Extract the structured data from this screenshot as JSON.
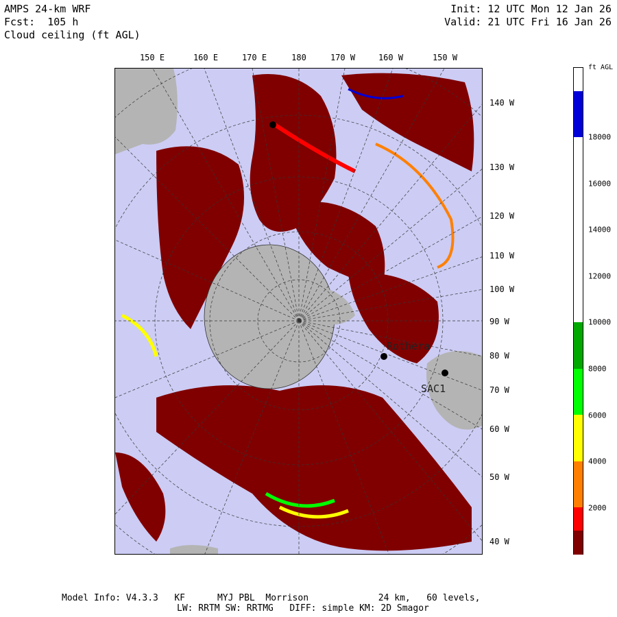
{
  "header": {
    "model": "AMPS 24-km WRF",
    "forecast": "Fcst:  105 h",
    "field": "Cloud ceiling (ft AGL)",
    "init": "Init: 12 UTC Mon 12 Jan 26",
    "valid": "Valid: 21 UTC Fri 16 Jan 26"
  },
  "longitude_labels_top": [
    "150 E",
    "160 E",
    "170 E",
    "180",
    "170 W",
    "160 W",
    "150 W"
  ],
  "longitude_labels_right": [
    "140 W",
    "130 W",
    "120 W",
    "110 W",
    "100 W",
    "90 W",
    "80 W",
    "70 W",
    "60 W",
    "50 W",
    "40 W"
  ],
  "colorbar": {
    "unit": "ft AGL",
    "ticks": [
      "18000",
      "16000",
      "14000",
      "12000",
      "10000",
      "8000",
      "6000",
      "4000",
      "2000"
    ],
    "colors": [
      "#ffffff",
      "#0000d8",
      "#0000d8",
      "#ffffff",
      "#ffffff",
      "#ffffff",
      "#ffffff",
      "#ffffff",
      "#ffffff",
      "#ffffff",
      "#ffffff",
      "#00a800",
      "#00a800",
      "#00ff00",
      "#00ff00",
      "#ffff00",
      "#ffff00",
      "#ff8000",
      "#ff8000",
      "#ff0000",
      "#800000"
    ]
  },
  "stations": [
    "Rothera",
    "SAC1"
  ],
  "footer": {
    "line1": "Model Info: V4.3.3   KF      MYJ PBL  Morrison             24 km,   60 levels,",
    "line2": "LW: RRTM SW: RRTMG   DIFF: simple KM: 2D Smagor"
  },
  "colors": {
    "ocean": "#ccccf4",
    "land": "#b4b4b4",
    "ceiling_lowest": "#800000"
  }
}
